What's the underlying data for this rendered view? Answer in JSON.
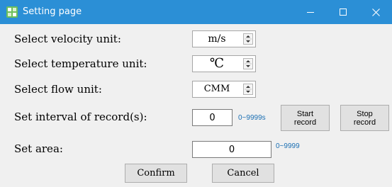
{
  "window": {
    "title": "Setting page",
    "icons": {
      "app": "app-icon",
      "minimize": "minimize-icon",
      "maximize": "maximize-icon",
      "close": "close-icon"
    },
    "titlebar_color": "#2b8fd6"
  },
  "rows": {
    "velocity": {
      "label": "Select velocity unit:",
      "value": "m/s"
    },
    "temperature": {
      "label": "Select temperature unit:",
      "value": "℃"
    },
    "flow": {
      "label": "Select flow unit:",
      "value": "CMM"
    },
    "interval": {
      "label": "Set interval of record(s):",
      "value": "0",
      "range": "0~9999s"
    },
    "area": {
      "label": "Set area:",
      "value": "0",
      "range": "0~9999"
    }
  },
  "buttons": {
    "start_record": "Start\nrecord",
    "stop_record": "Stop\nrecord",
    "confirm": "Confirm",
    "cancel": "Cancel"
  },
  "colors": {
    "range_text": "#1b6fb3"
  }
}
